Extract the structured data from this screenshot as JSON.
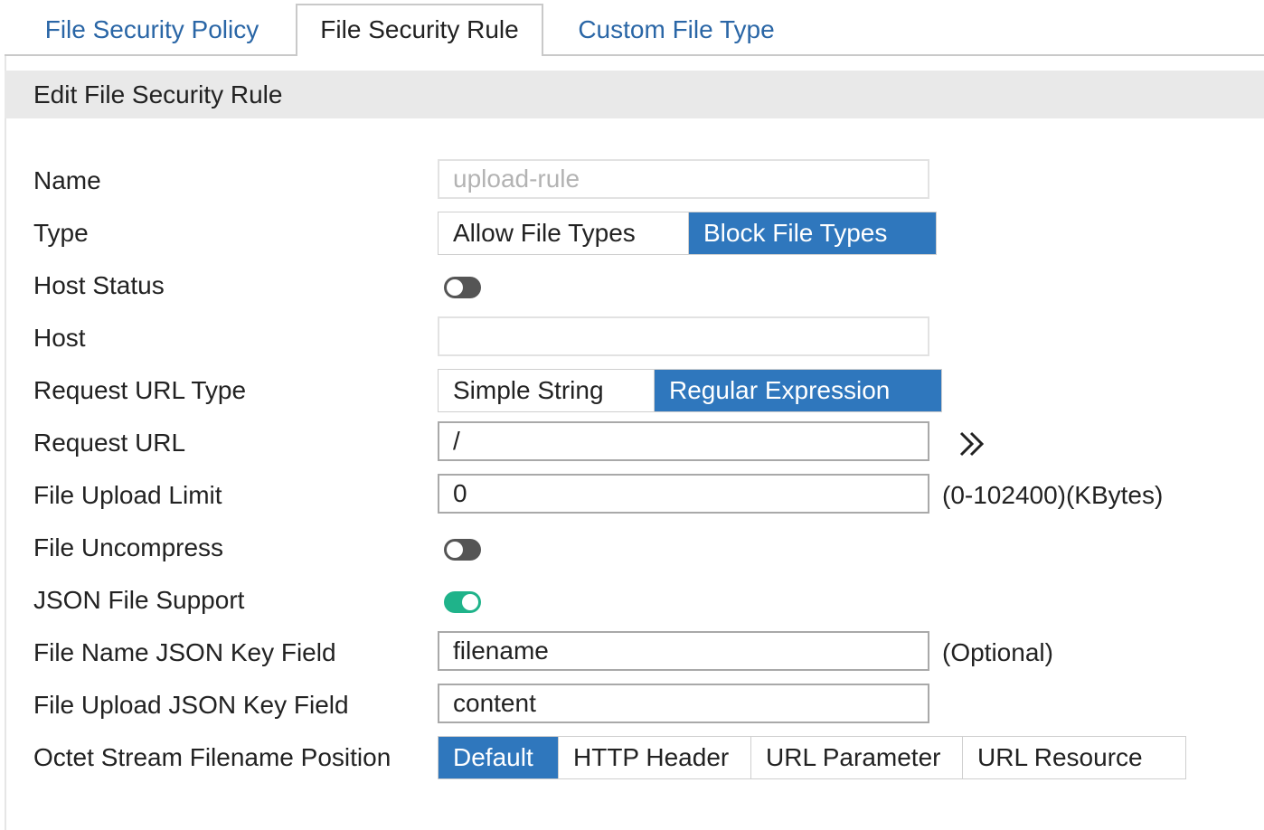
{
  "tabs": [
    {
      "label": "File Security Policy",
      "active": false
    },
    {
      "label": "File Security Rule",
      "active": true
    },
    {
      "label": "Custom File Type",
      "active": false
    }
  ],
  "section_title": "Edit File Security Rule",
  "form": {
    "name": {
      "label": "Name",
      "value": "upload-rule"
    },
    "type": {
      "label": "Type",
      "options": [
        "Allow File Types",
        "Block File Types"
      ],
      "selected": "Block File Types"
    },
    "host_status": {
      "label": "Host Status",
      "enabled": false
    },
    "host": {
      "label": "Host",
      "value": ""
    },
    "request_url_type": {
      "label": "Request URL Type",
      "options": [
        "Simple String",
        "Regular Expression"
      ],
      "selected": "Regular Expression"
    },
    "request_url": {
      "label": "Request URL",
      "value": "/",
      "expand_icon": "double-chevron-right-icon"
    },
    "file_upload_limit": {
      "label": "File Upload Limit",
      "value": "0",
      "hint": "(0-102400)(KBytes)"
    },
    "file_uncompress": {
      "label": "File Uncompress",
      "enabled": false
    },
    "json_file_support": {
      "label": "JSON File Support",
      "enabled": true
    },
    "file_name_json_key": {
      "label": "File Name JSON Key Field",
      "value": "filename",
      "hint": "(Optional)"
    },
    "file_upload_json_key": {
      "label": "File Upload JSON Key Field",
      "value": "content"
    },
    "octet_stream_position": {
      "label": "Octet Stream Filename Position",
      "options": [
        "Default",
        "HTTP Header",
        "URL Parameter",
        "URL Resource"
      ],
      "selected": "Default"
    }
  },
  "colors": {
    "accent": "#2f77bd",
    "tab_link": "#2a66a6",
    "toggle_on": "#1fb38a",
    "toggle_off": "#555555",
    "header_bg": "#e9e9e9"
  }
}
